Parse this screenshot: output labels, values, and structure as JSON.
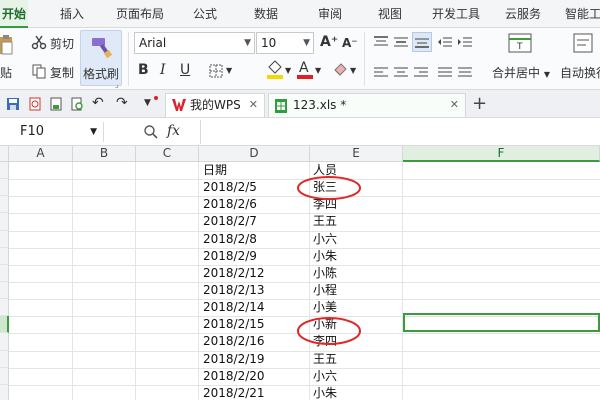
{
  "menu": {
    "tabs": [
      "开始",
      "插入",
      "页面布局",
      "公式",
      "数据",
      "审阅",
      "视图",
      "开发工具",
      "云服务",
      "智能工"
    ]
  },
  "ribbon": {
    "paste_label": "贴",
    "cut_label": "剪切",
    "copy_label": "复制",
    "format_painter_label": "格式刷",
    "font_name": "Arial",
    "font_size": "10",
    "bold": "B",
    "italic": "I",
    "underline": "U",
    "grow_font": "A⁺",
    "shrink_font": "A⁻",
    "merge_label": "合并居中",
    "wrap_label": "自动换行",
    "font_color": "#e02020",
    "highlight_color": "#f5d800"
  },
  "doc_tabs": {
    "wps_tab": "我的WPS",
    "file_tab": "123.xls *",
    "new_tab": "+"
  },
  "formula_bar": {
    "name_box": "F10",
    "fx": "fx",
    "value": ""
  },
  "sheet": {
    "columns": [
      "A",
      "B",
      "C",
      "D",
      "E",
      "F"
    ],
    "selected_column": "F",
    "rows": [
      {
        "d": "日期",
        "e": "人员"
      },
      {
        "d": "2018/2/5",
        "e": "张三"
      },
      {
        "d": "2018/2/6",
        "e": "李四"
      },
      {
        "d": "2018/2/7",
        "e": "王五"
      },
      {
        "d": "2018/2/8",
        "e": "小六"
      },
      {
        "d": "2018/2/9",
        "e": "小朱"
      },
      {
        "d": "2018/2/12",
        "e": "小陈"
      },
      {
        "d": "2018/2/13",
        "e": "小程"
      },
      {
        "d": "2018/2/14",
        "e": "小美"
      },
      {
        "d": "2018/2/15",
        "e": "小新"
      },
      {
        "d": "2018/2/16",
        "e": "李四"
      },
      {
        "d": "2018/2/19",
        "e": "王五"
      },
      {
        "d": "2018/2/20",
        "e": "小六"
      },
      {
        "d": "2018/2/21",
        "e": "小朱"
      }
    ]
  },
  "annotation_color": "#e02828"
}
